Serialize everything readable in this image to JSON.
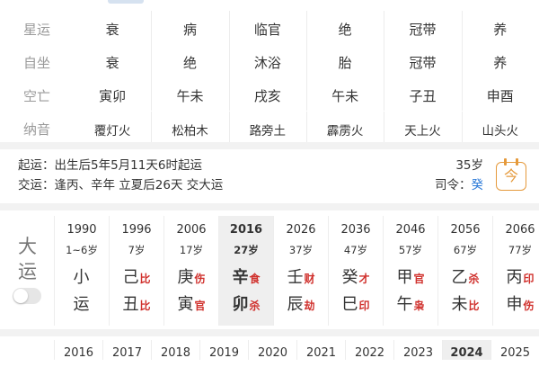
{
  "pillar_table": {
    "rows": [
      {
        "label": "星运",
        "values": [
          "衰",
          "病",
          "临官",
          "绝",
          "冠带",
          "养"
        ]
      },
      {
        "label": "自坐",
        "values": [
          "衰",
          "绝",
          "沐浴",
          "胎",
          "冠带",
          "养"
        ]
      },
      {
        "label": "空亡",
        "values": [
          "寅卯",
          "午未",
          "戌亥",
          "午未",
          "子丑",
          "申酉"
        ]
      },
      {
        "label": "纳音",
        "values": [
          "覆灯火",
          "松柏木",
          "路旁土",
          "霹雳火",
          "天上火",
          "山头火"
        ]
      }
    ]
  },
  "start_luck": {
    "line1": "起运：出生后5年5月11天6时起运",
    "line2": "交运：逢丙、辛年 立夏后26天 交大运",
    "age": "35岁",
    "siling_label": "司令：",
    "siling_value": "癸",
    "calendar_icon_char": "今"
  },
  "dayun": {
    "label_line1": "大",
    "label_line2": "运",
    "toggle_on": false,
    "columns": [
      {
        "year": "1990",
        "age": "1~6岁",
        "gan": "小",
        "gan_tag": "",
        "zhi": "运",
        "zhi_tag": "",
        "active": false
      },
      {
        "year": "1996",
        "age": "7岁",
        "gan": "己",
        "gan_tag": "比",
        "zhi": "丑",
        "zhi_tag": "比",
        "active": false
      },
      {
        "year": "2006",
        "age": "17岁",
        "gan": "庚",
        "gan_tag": "伤",
        "zhi": "寅",
        "zhi_tag": "官",
        "active": false
      },
      {
        "year": "2016",
        "age": "27岁",
        "gan": "辛",
        "gan_tag": "食",
        "zhi": "卯",
        "zhi_tag": "杀",
        "active": true
      },
      {
        "year": "2026",
        "age": "37岁",
        "gan": "壬",
        "gan_tag": "财",
        "zhi": "辰",
        "zhi_tag": "劫",
        "active": false
      },
      {
        "year": "2036",
        "age": "47岁",
        "gan": "癸",
        "gan_tag": "才",
        "zhi": "巳",
        "zhi_tag": "印",
        "active": false
      },
      {
        "year": "2046",
        "age": "57岁",
        "gan": "甲",
        "gan_tag": "官",
        "zhi": "午",
        "zhi_tag": "枭",
        "active": false
      },
      {
        "year": "2056",
        "age": "67岁",
        "gan": "乙",
        "gan_tag": "杀",
        "zhi": "未",
        "zhi_tag": "比",
        "active": false
      },
      {
        "year": "2066",
        "age": "77岁",
        "gan": "丙",
        "gan_tag": "印",
        "zhi": "申",
        "zhi_tag": "伤",
        "active": false
      }
    ]
  },
  "liunian": {
    "years": [
      "2016",
      "2017",
      "2018",
      "2019",
      "2020",
      "2021",
      "2022",
      "2023",
      "2024",
      "2025"
    ],
    "active_index": 8
  },
  "colors": {
    "tag_red": "#d0312d",
    "accent_blue": "#2d7bd8",
    "calendar_orange": "#e59a3c"
  }
}
